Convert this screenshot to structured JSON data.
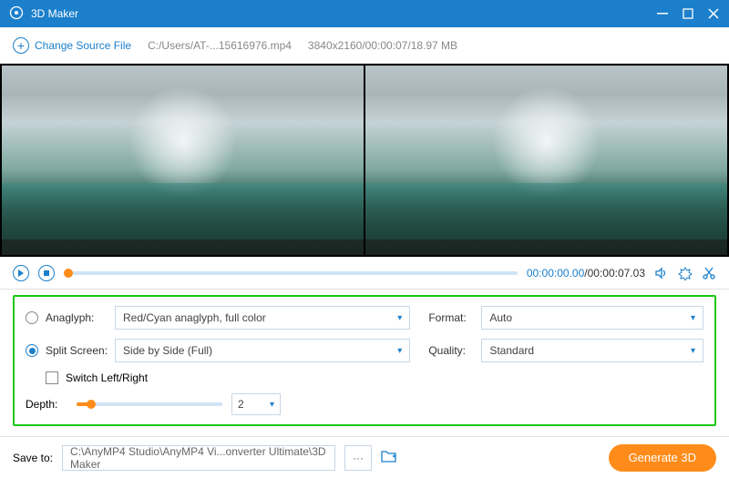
{
  "titlebar": {
    "title": "3D Maker"
  },
  "toolbar": {
    "change_source_label": "Change Source File",
    "file_path": "C:/Users/AT-...15616976.mp4",
    "file_meta": "3840x2160/00:00:07/18.97 MB"
  },
  "playbar": {
    "current_time": "00:00:00.00",
    "duration": "/00:00:07.03"
  },
  "settings": {
    "anaglyph_label": "Anaglyph:",
    "anaglyph_value": "Red/Cyan anaglyph, full color",
    "split_label": "Split Screen:",
    "split_value": "Side by Side (Full)",
    "switch_lr_label": "Switch Left/Right",
    "depth_label": "Depth:",
    "depth_value": "2",
    "format_label": "Format:",
    "format_value": "Auto",
    "quality_label": "Quality:",
    "quality_value": "Standard"
  },
  "footer": {
    "save_to_label": "Save to:",
    "save_path": "C:\\AnyMP4 Studio\\AnyMP4 Vi...onverter Ultimate\\3D Maker",
    "browse": "···",
    "generate_label": "Generate 3D"
  }
}
